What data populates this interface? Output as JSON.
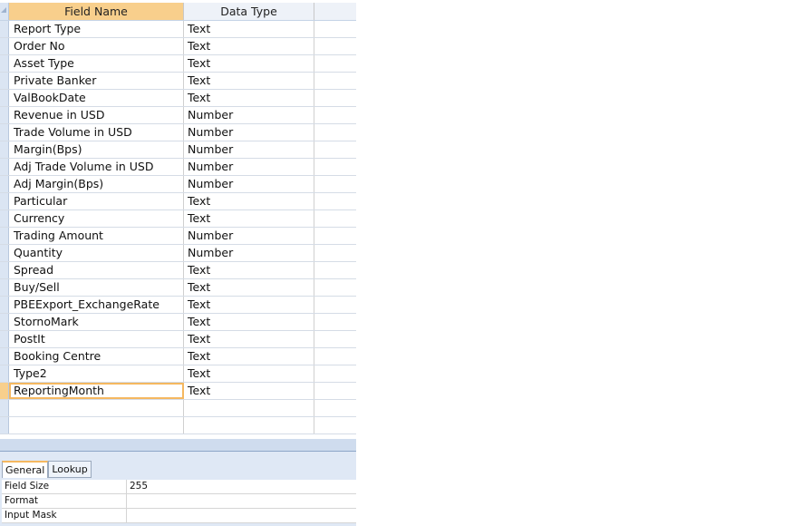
{
  "columns": {
    "field_name": "Field Name",
    "data_type": "Data Type"
  },
  "fields": [
    {
      "name": "Report Type",
      "type": "Text"
    },
    {
      "name": "Order No",
      "type": "Text"
    },
    {
      "name": "Asset Type",
      "type": "Text"
    },
    {
      "name": "Private Banker",
      "type": "Text"
    },
    {
      "name": "ValBookDate",
      "type": "Text"
    },
    {
      "name": "Revenue in USD",
      "type": "Number"
    },
    {
      "name": "Trade Volume in USD",
      "type": "Number"
    },
    {
      "name": "Margin(Bps)",
      "type": "Number"
    },
    {
      "name": "Adj Trade Volume in USD",
      "type": "Number"
    },
    {
      "name": "Adj Margin(Bps)",
      "type": "Number"
    },
    {
      "name": "Particular",
      "type": "Text"
    },
    {
      "name": "Currency",
      "type": "Text"
    },
    {
      "name": "Trading Amount",
      "type": "Number"
    },
    {
      "name": "Quantity",
      "type": "Number"
    },
    {
      "name": "Spread",
      "type": "Text"
    },
    {
      "name": "Buy/Sell",
      "type": "Text"
    },
    {
      "name": "PBEExport_ExchangeRate",
      "type": "Text"
    },
    {
      "name": "StornoMark",
      "type": "Text"
    },
    {
      "name": "PostIt",
      "type": "Text"
    },
    {
      "name": "Booking Centre",
      "type": "Text"
    },
    {
      "name": "Type2",
      "type": "Text"
    },
    {
      "name": "ReportingMonth",
      "type": "Text"
    }
  ],
  "tabs": [
    "General",
    "Lookup"
  ],
  "properties": [
    {
      "label": "Field Size",
      "value": "255"
    },
    {
      "label": "Format",
      "value": ""
    },
    {
      "label": "Input Mask",
      "value": ""
    }
  ]
}
